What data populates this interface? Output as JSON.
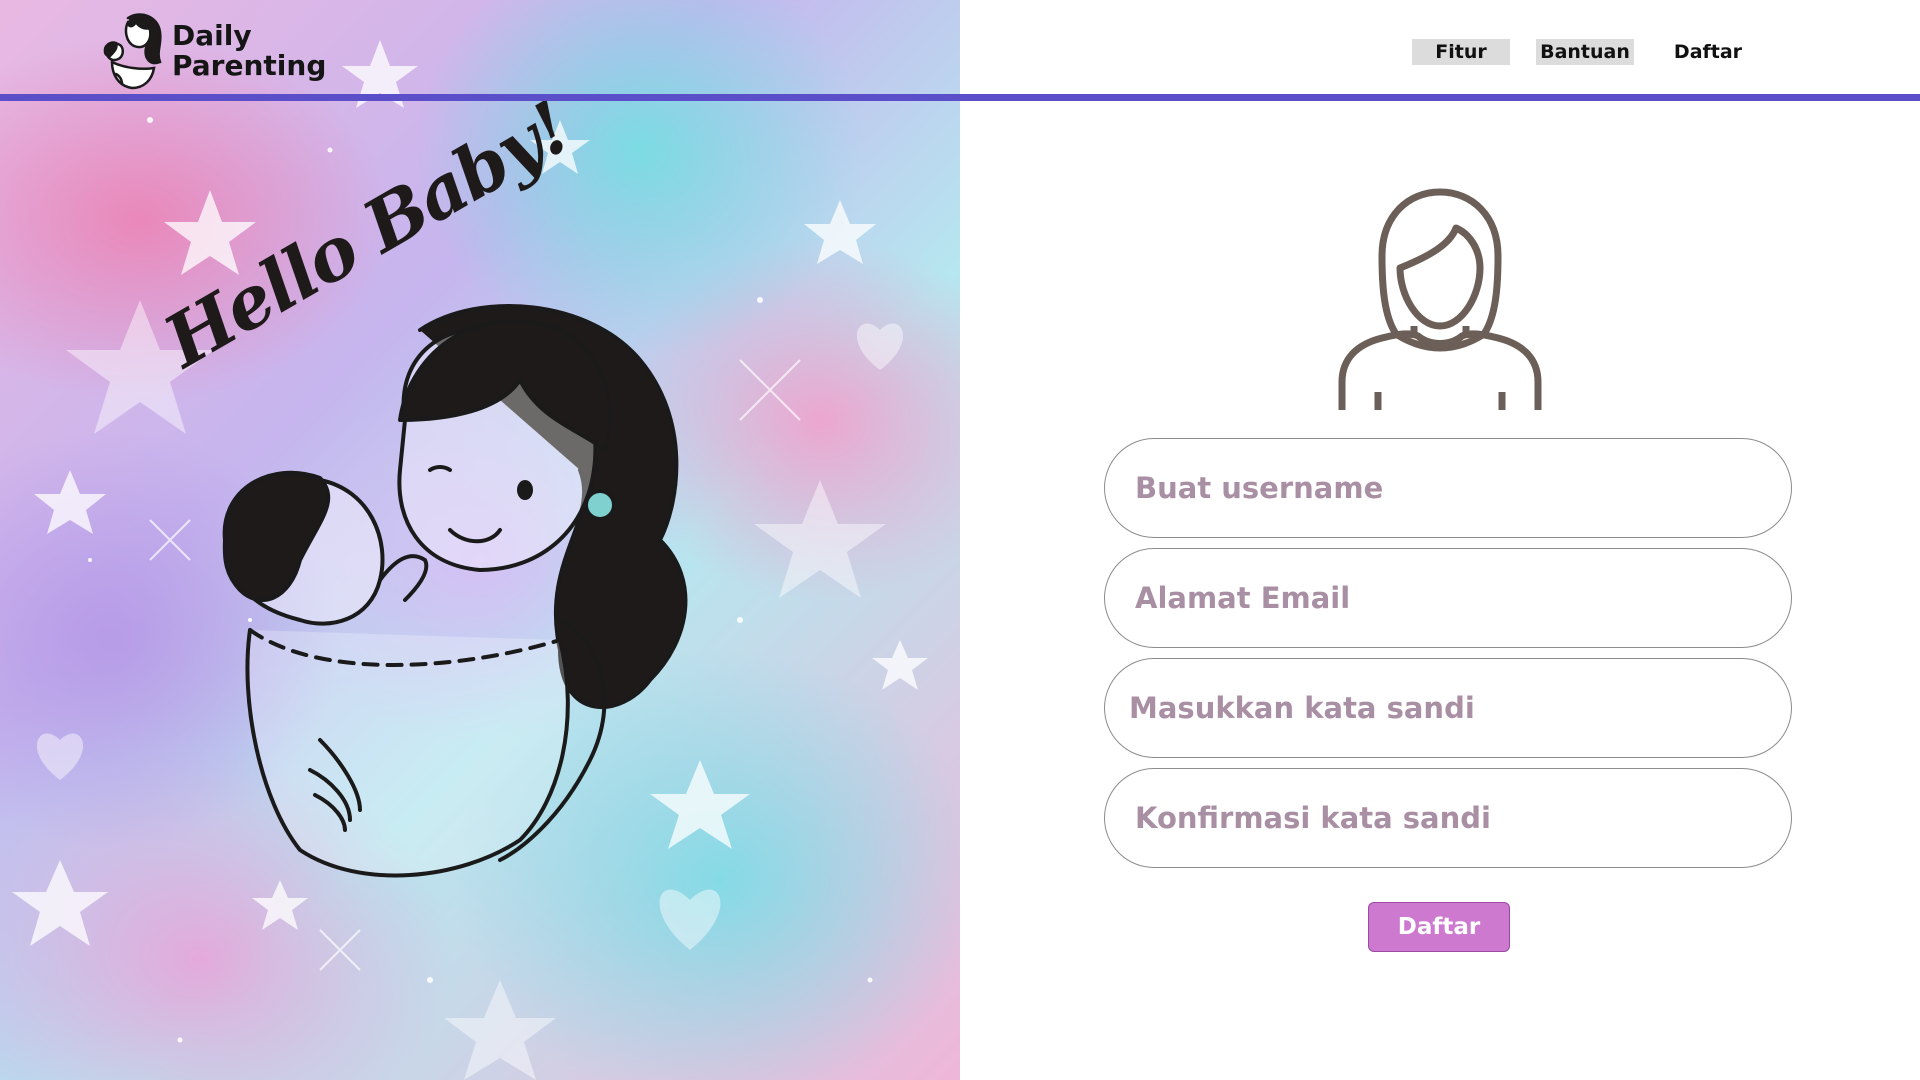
{
  "brand": {
    "name_line1": "Daily",
    "name_line2": "Parenting"
  },
  "nav": {
    "items": [
      {
        "label": "Fitur"
      },
      {
        "label": "Bantuan"
      },
      {
        "label": "Daftar"
      }
    ]
  },
  "hero": {
    "script_text": "Hello Baby!"
  },
  "form": {
    "username_placeholder": "Buat username",
    "email_placeholder": "Alamat Email",
    "password_placeholder": "Masukkan kata sandi",
    "confirm_placeholder": "Konfirmasi kata sandi",
    "submit_label": "Daftar"
  },
  "icons": {
    "avatar": "woman-avatar-icon",
    "logo": "mother-baby-logo-icon"
  },
  "colors": {
    "header_bar": "#5a4fc9",
    "submit_bg": "#cc79cf",
    "placeholder": "#a98fa3",
    "nav_pill": "#dcdcdc"
  }
}
